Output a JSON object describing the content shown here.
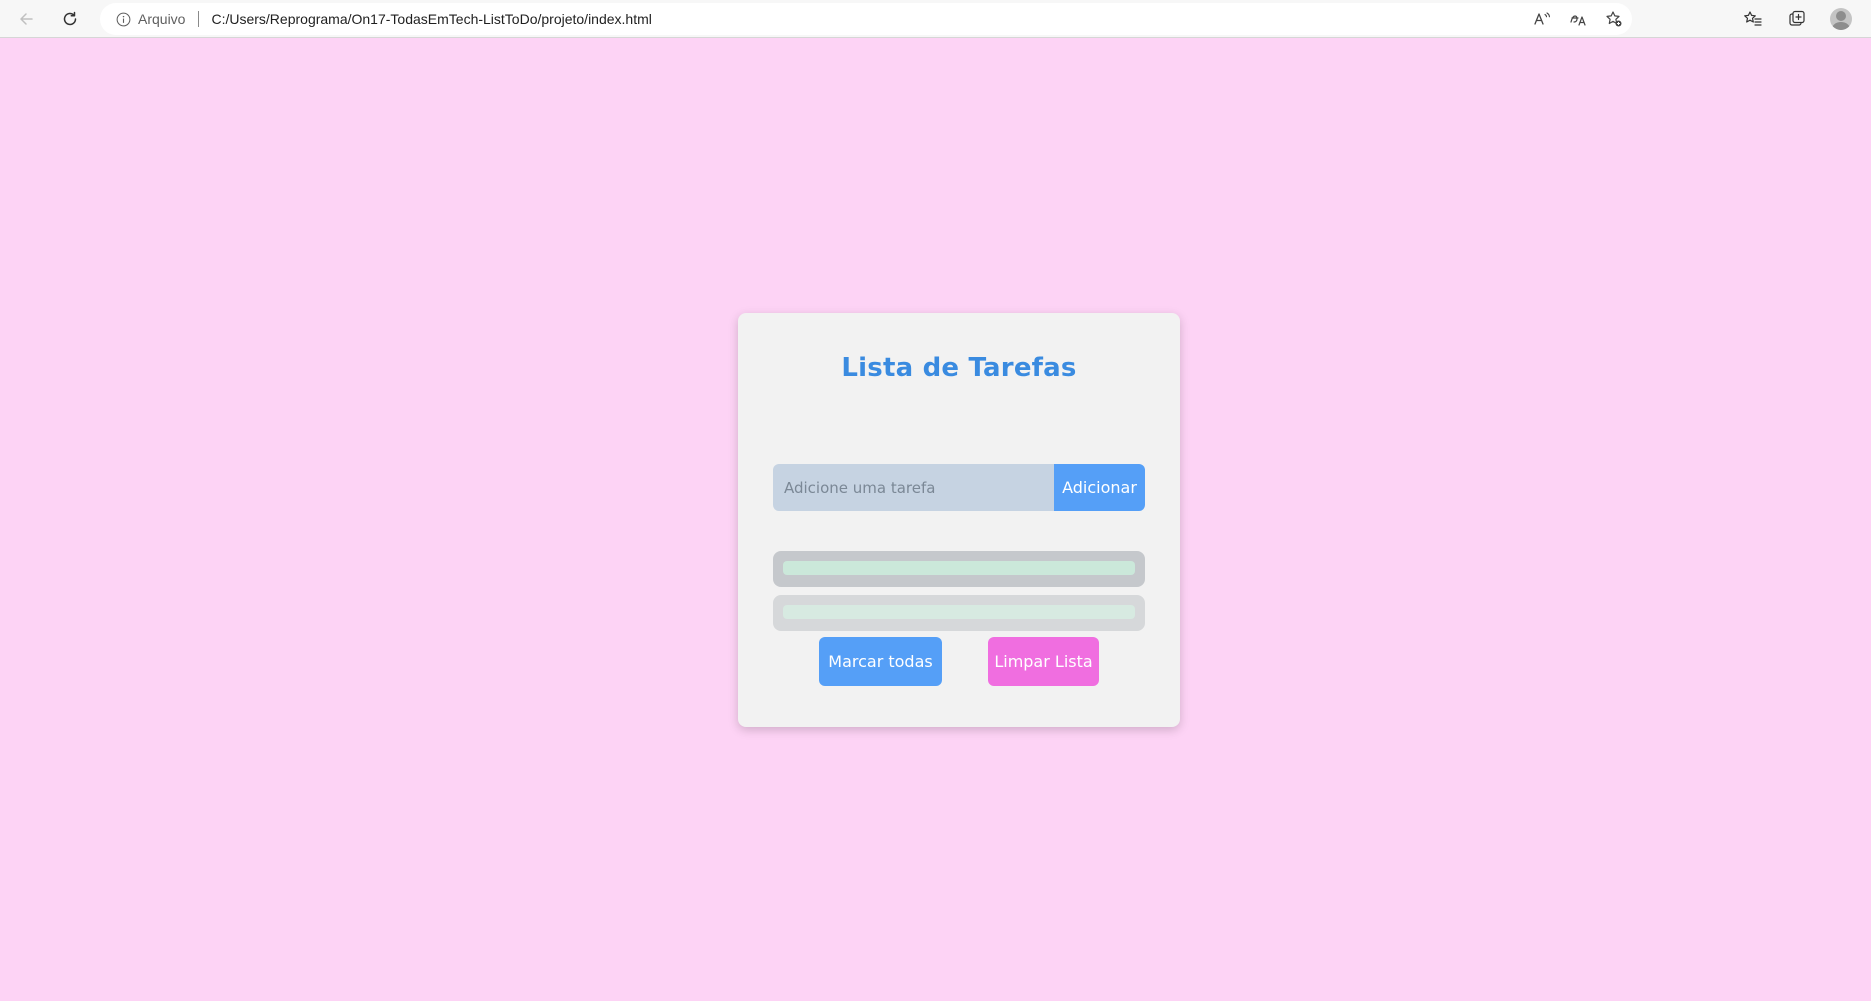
{
  "browser": {
    "site_info_label": "Arquivo",
    "url": "C:/Users/Reprograma/On17-TodasEmTech-ListToDo/projeto/index.html"
  },
  "todo": {
    "title": "Lista de Tarefas",
    "input_placeholder": "Adicione uma tarefa",
    "input_value": "",
    "add_label": "Adicionar",
    "mark_all_label": "Marcar todas",
    "clear_label": "Limpar Lista",
    "tasks": [
      {
        "text": ""
      },
      {
        "text": ""
      }
    ]
  },
  "colors": {
    "page_background": "#fdd3f5",
    "card_background": "#f2f2f2",
    "title": "#3a8be0",
    "primary_button": "#559ff7",
    "danger_button": "#f06ee0",
    "input_background": "#c6d3e2"
  }
}
